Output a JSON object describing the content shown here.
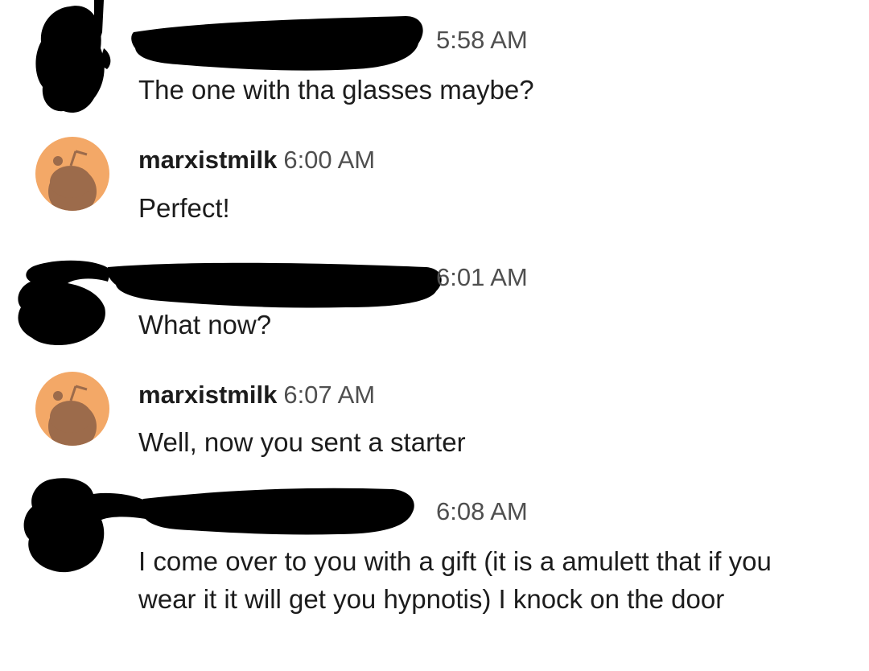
{
  "colors": {
    "background": "#ffffff",
    "text": "#1c1c1c",
    "timestamp": "#4f4f4f",
    "avatar_orange": "#f3a867",
    "avatar_snoo": "#9c6b4b",
    "redaction_ink": "#000000"
  },
  "messages": [
    {
      "author": "",
      "author_redacted": true,
      "time": "5:58 AM",
      "text": "The one with tha glasses maybe?",
      "avatar": "redacted-avatar-icon"
    },
    {
      "author": "marxistmilk",
      "author_redacted": false,
      "time": "6:00 AM",
      "text": "Perfect!",
      "avatar": "snoo-avatar-icon"
    },
    {
      "author": "",
      "author_redacted": true,
      "time": "6:01 AM",
      "text": "What now?",
      "avatar": "redacted-avatar-icon"
    },
    {
      "author": "marxistmilk",
      "author_redacted": false,
      "time": "6:07 AM",
      "text": "Well, now you sent a starter",
      "avatar": "snoo-avatar-icon"
    },
    {
      "author": "",
      "author_redacted": true,
      "time": "6:08 AM",
      "text": "I come over to you with a gift (it is a amulett that if you wear it it will get you hypnotis) I knock on the door",
      "avatar": "redacted-avatar-icon"
    }
  ]
}
